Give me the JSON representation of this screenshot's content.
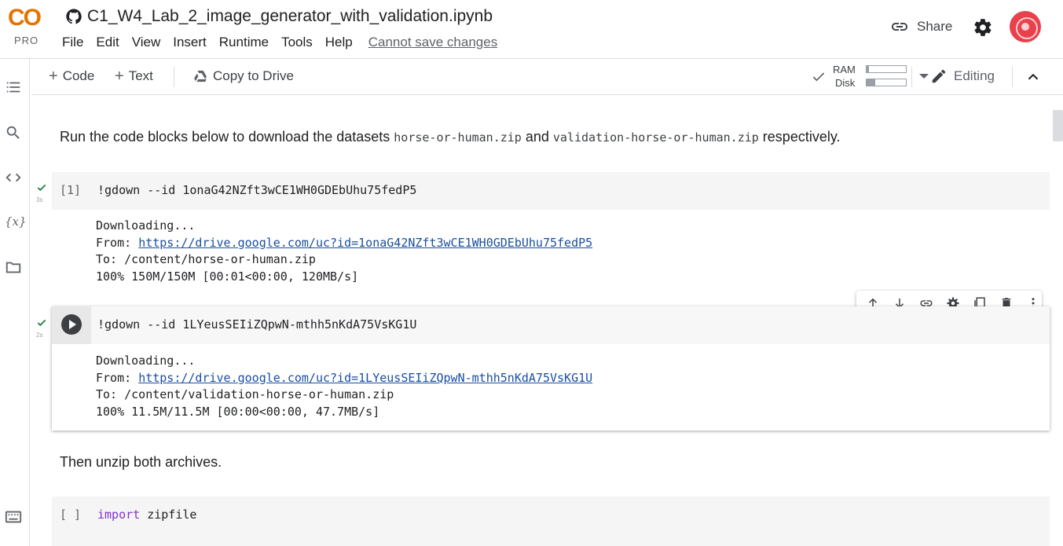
{
  "app": {
    "logo_text": "CO",
    "logo_sub": "PRO",
    "notebook_title": "C1_W4_Lab_2_image_generator_with_validation.ipynb"
  },
  "menu": {
    "items": [
      "File",
      "Edit",
      "View",
      "Insert",
      "Runtime",
      "Tools",
      "Help"
    ],
    "cannot_save": "Cannot save changes"
  },
  "header": {
    "share_label": "Share"
  },
  "toolbar": {
    "add_code": "Code",
    "add_text": "Text",
    "copy_to_drive": "Copy to Drive",
    "ram_label": "RAM",
    "disk_label": "Disk",
    "ram_usage": 0.05,
    "disk_usage": 0.22,
    "editing_label": "Editing"
  },
  "cells": {
    "intro_text_prefix": "Run the code blocks below to download the datasets ",
    "intro_code_1": "horse-or-human.zip",
    "intro_and": " and ",
    "intro_code_2": "validation-horse-or-human.zip",
    "intro_suffix": " respectively.",
    "cell1": {
      "exec_count": "[1]",
      "code": "!gdown --id 1onaG42NZft3wCE1WH0GDEbUhu75fedP5",
      "status_time": "3s",
      "out_downloading": "Downloading...",
      "out_from_label": "From: ",
      "out_from_url": "https://drive.google.com/uc?id=1onaG42NZft3wCE1WH0GDEbUhu75fedP5",
      "out_to": "To: /content/horse-or-human.zip",
      "out_progress": "100% 150M/150M [00:01<00:00, 120MB/s]"
    },
    "cell2": {
      "code": "!gdown --id 1LYeusSEIiZQpwN-mthh5nKdA75VsKG1U",
      "status_time": "2s",
      "out_downloading": "Downloading...",
      "out_from_label": "From: ",
      "out_from_url": "https://drive.google.com/uc?id=1LYeusSEIiZQpwN-mthh5nKdA75VsKG1U",
      "out_to": "To: /content/validation-horse-or-human.zip",
      "out_progress": "100% 11.5M/11.5M [00:00<00:00, 47.7MB/s]"
    },
    "unzip_text": "Then unzip both archives.",
    "cell3": {
      "exec_count": "[ ]",
      "code_kw": "import",
      "code_rest": " zipfile"
    }
  }
}
